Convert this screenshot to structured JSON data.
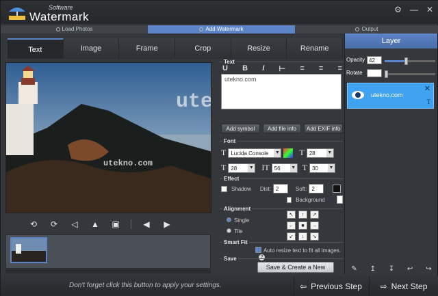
{
  "app": {
    "brand_small": "Software",
    "brand_big": "Watermark",
    "window_buttons": [
      "⚙",
      "—",
      "✕"
    ]
  },
  "steps": [
    "Load Photos",
    "Add Watermark",
    "Output"
  ],
  "tabs": [
    "Text",
    "Image",
    "Frame",
    "Crop",
    "Resize",
    "Rename"
  ],
  "preview": {
    "overlay_text": "utekno.com"
  },
  "panel": {
    "text_section": "Text",
    "text_value": "utekno.com",
    "buttons": [
      "Add symbol",
      "Add file info",
      "Add EXIF info"
    ],
    "font_section": "Font",
    "font_name": "Lucida Console",
    "font_size": "28",
    "line_height": "28",
    "char_spacing": "56",
    "char_width": "30",
    "effect_section": "Effect",
    "shadow_label": "Shadow",
    "dist_label": "Dist:",
    "dist_value": "2",
    "soft_label": "Soft:",
    "soft_value": "2",
    "background_label": "Background",
    "alignment_section": "Alignment",
    "single_label": "Single",
    "tile_label": "Tile",
    "smartfit_section": "Smart Fit",
    "smartfit_text": "Auto resize text to fit all images.",
    "save_section": "Save",
    "save_button": "Save & Create a New Layer"
  },
  "layer": {
    "title": "Layer",
    "opacity_label": "Opacity",
    "opacity_value": "42",
    "rotate_label": "Rotate",
    "rotate_value": "",
    "item_name": "utekno.com"
  },
  "footer": {
    "hint": "Don't forget click this button to apply your settings.",
    "previous": "Previous Step",
    "next": "Next Step"
  },
  "colors": {
    "accent": "#5e84c8",
    "layer_selected": "#3fa3f0"
  }
}
